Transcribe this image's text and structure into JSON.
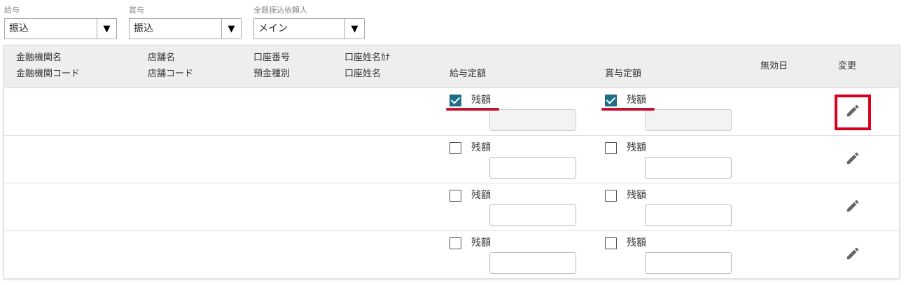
{
  "filters": {
    "salary": {
      "label": "給与",
      "value": "振込"
    },
    "bonus": {
      "label": "賞与",
      "value": "振込"
    },
    "requester": {
      "label": "全銀振込依頼人",
      "value": "メイン"
    }
  },
  "table": {
    "headers": {
      "bank_name": "金融機関名",
      "bank_code": "金融機関コード",
      "branch_name": "店舗名",
      "branch_code": "店舗コード",
      "account_number": "口座番号",
      "deposit_type": "預金種別",
      "account_holder_kana": "口座姓名ｶﾅ",
      "account_holder": "口座姓名",
      "salary_fixed": "給与定額",
      "bonus_fixed": "賞与定額",
      "invalid_date": "無効日",
      "change": "変更"
    },
    "rows": [
      {
        "salary_remainder": {
          "label": "残額",
          "checked": true,
          "amount": ""
        },
        "bonus_remainder": {
          "label": "残額",
          "checked": true,
          "amount": ""
        }
      },
      {
        "salary_remainder": {
          "label": "残額",
          "checked": false,
          "amount": ""
        },
        "bonus_remainder": {
          "label": "残額",
          "checked": false,
          "amount": ""
        }
      },
      {
        "salary_remainder": {
          "label": "残額",
          "checked": false,
          "amount": ""
        },
        "bonus_remainder": {
          "label": "残額",
          "checked": false,
          "amount": ""
        }
      },
      {
        "salary_remainder": {
          "label": "残額",
          "checked": false,
          "amount": ""
        },
        "bonus_remainder": {
          "label": "残額",
          "checked": false,
          "amount": ""
        }
      }
    ]
  },
  "icons": {
    "dropdown": "triangle-down-icon",
    "edit": "pencil-icon"
  },
  "colors": {
    "checkbox_checked": "#1e6f86",
    "annotation_red": "#c8102e",
    "header_bg": "#eeeeee"
  }
}
